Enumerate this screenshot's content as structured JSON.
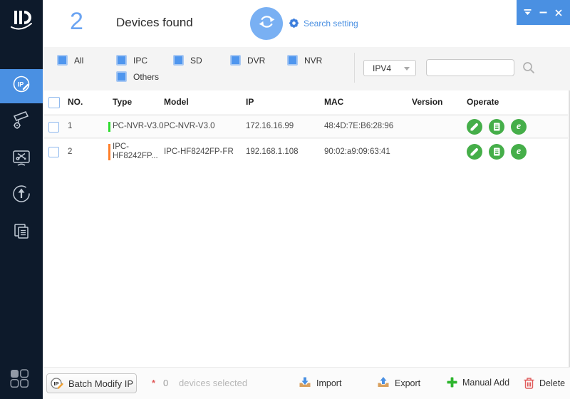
{
  "header": {
    "device_count": "2",
    "title": "Devices found",
    "search_setting_label": "Search setting"
  },
  "filters": {
    "options": [
      {
        "label": "All",
        "checked": true
      },
      {
        "label": "IPC",
        "checked": true
      },
      {
        "label": "SD",
        "checked": true
      },
      {
        "label": "DVR",
        "checked": true
      },
      {
        "label": "NVR",
        "checked": true
      },
      {
        "label": "Others",
        "checked": true
      }
    ]
  },
  "search": {
    "protocol_selected": "IPV4",
    "query_value": "",
    "query_placeholder": ""
  },
  "table": {
    "columns": [
      "NO.",
      "Type",
      "Model",
      "IP",
      "MAC",
      "Version",
      "Operate"
    ],
    "rows": [
      {
        "no": "1",
        "type_lines": [
          "PC-NVR-V3.0"
        ],
        "status_color": "#2fdc2f",
        "model": "PC-NVR-V3.0",
        "ip": "172.16.16.99",
        "mac": "48:4D:7E:B6:28:96",
        "version": "",
        "checked": false
      },
      {
        "no": "2",
        "type_lines": [
          "IPC-",
          "HF8242FP..."
        ],
        "status_color": "#ff7f2a",
        "model": "IPC-HF8242FP-FR",
        "ip": "192.168.1.108",
        "mac": "90:02:a9:09:63:41",
        "version": "",
        "checked": false
      }
    ]
  },
  "icons": {
    "browser_glyph": "e"
  },
  "footer": {
    "batch_modify_label": "Batch Modify IP",
    "required_mark": "*",
    "selected_count": "0",
    "selected_label": "devices selected",
    "import_label": "Import",
    "export_label": "Export",
    "manual_add_label": "Manual Add",
    "delete_label": "Delete"
  },
  "colors": {
    "accent_blue": "#4a90e2",
    "sidebar_bg": "#0d1a2b",
    "operate_green": "#45ae49",
    "status_green": "#2fdc2f",
    "status_orange": "#ff7f2a",
    "delete_red": "#e05c5c"
  }
}
